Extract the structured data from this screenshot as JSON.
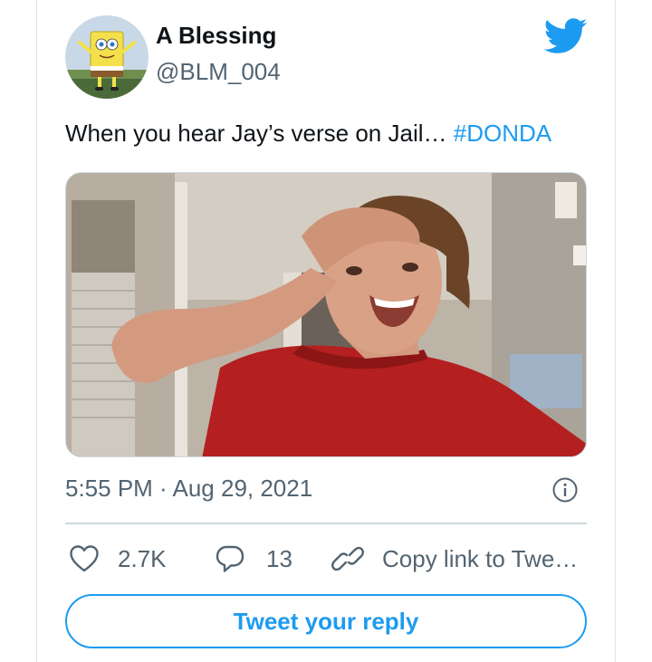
{
  "author": {
    "display_name": "A Blessing",
    "handle": "@BLM_004"
  },
  "tweet": {
    "text": "When you hear Jay’s verse on Jail… ",
    "hashtag": "#DONDA"
  },
  "meta": {
    "timestamp": "5:55 PM · Aug 29, 2021"
  },
  "actions": {
    "likes": "2.7K",
    "replies": "13",
    "copy_link_label": "Copy link to Twe…"
  },
  "reply_button_label": "Tweet your reply",
  "icons": {
    "like": "heart-icon",
    "reply": "speech-bubble-icon",
    "copy": "link-icon",
    "info": "info-icon",
    "brand": "twitter-bird-icon"
  },
  "colors": {
    "accent": "#1d9bf0",
    "secondary_text": "#536471",
    "divider": "#cfd9de"
  }
}
